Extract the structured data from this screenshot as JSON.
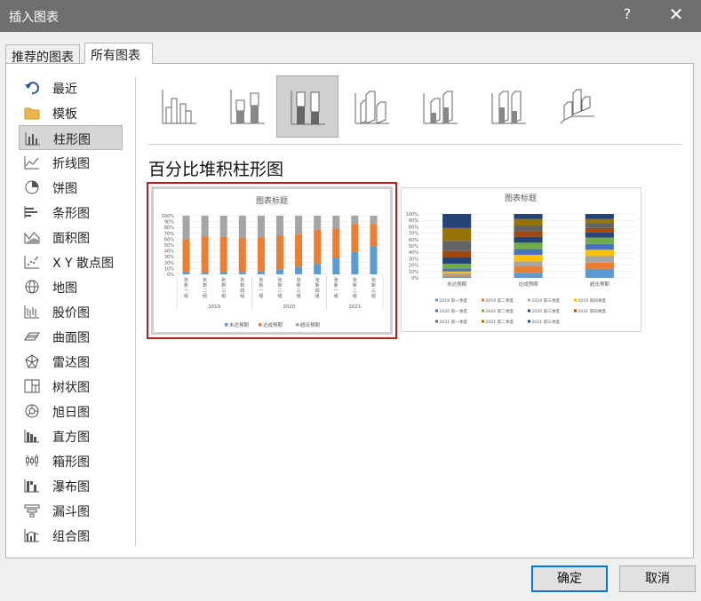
{
  "window": {
    "title": "插入图表",
    "help": "?",
    "close": "✕"
  },
  "tabs": [
    {
      "label": "推荐的图表",
      "active": false
    },
    {
      "label": "所有图表",
      "active": true
    }
  ],
  "sidebar": {
    "items": [
      {
        "label": "最近",
        "icon": "undo-arrow-icon"
      },
      {
        "label": "模板",
        "icon": "folder-icon"
      },
      {
        "label": "柱形图",
        "icon": "column-chart-icon",
        "selected": true
      },
      {
        "label": "折线图",
        "icon": "line-chart-icon"
      },
      {
        "label": "饼图",
        "icon": "pie-chart-icon"
      },
      {
        "label": "条形图",
        "icon": "bar-chart-icon"
      },
      {
        "label": "面积图",
        "icon": "area-chart-icon"
      },
      {
        "label": "X Y 散点图",
        "icon": "scatter-chart-icon"
      },
      {
        "label": "地图",
        "icon": "globe-icon"
      },
      {
        "label": "股价图",
        "icon": "stock-chart-icon"
      },
      {
        "label": "曲面图",
        "icon": "surface-chart-icon"
      },
      {
        "label": "雷达图",
        "icon": "radar-chart-icon"
      },
      {
        "label": "树状图",
        "icon": "treemap-chart-icon"
      },
      {
        "label": "旭日图",
        "icon": "sunburst-chart-icon"
      },
      {
        "label": "直方图",
        "icon": "histogram-chart-icon"
      },
      {
        "label": "箱形图",
        "icon": "box-whisker-chart-icon"
      },
      {
        "label": "瀑布图",
        "icon": "waterfall-chart-icon"
      },
      {
        "label": "漏斗图",
        "icon": "funnel-chart-icon"
      },
      {
        "label": "组合图",
        "icon": "combo-chart-icon"
      }
    ]
  },
  "subtypes": {
    "selected_index": 2,
    "count": 7
  },
  "chart_subtitle": "百分比堆积柱形图",
  "colors": {
    "blue": "#5b9bd5",
    "orange": "#ed7d31",
    "gray": "#a5a5a5",
    "yellow": "#ffc000",
    "darkblue": "#264478",
    "green": "#70ad47",
    "brown": "#9e480e",
    "olive": "#997300",
    "selection_border": "#c21b1b"
  },
  "chart_data": [
    {
      "type": "bar",
      "stacked": "percent",
      "title": "图表标题",
      "categories": [
        "张 新 一 组",
        "张 新 二 组",
        "张 新 三 组",
        "张 新 四 组",
        "张 新 一 组",
        "张 新 二 组",
        "张 新 三 组",
        "张 新 四 组",
        "张 新 一 组",
        "张 新 二 组",
        "张 新 三 组"
      ],
      "groups": [
        {
          "label": "2019",
          "count": 4
        },
        {
          "label": "2020",
          "count": 4
        },
        {
          "label": "2021",
          "count": 3
        }
      ],
      "yticks": [
        "100%",
        "90%",
        "80%",
        "70%",
        "60%",
        "50%",
        "40%",
        "30%",
        "20%",
        "10%",
        "0%"
      ],
      "series": [
        {
          "name": "未达预期",
          "values": [
            4,
            3,
            4,
            4,
            5,
            8,
            13,
            18,
            28,
            38,
            48
          ]
        },
        {
          "name": "达成预期",
          "values": [
            56,
            62,
            60,
            58,
            58,
            58,
            55,
            58,
            50,
            48,
            38
          ]
        },
        {
          "name": "超出预期",
          "values": [
            40,
            35,
            36,
            38,
            37,
            34,
            32,
            24,
            22,
            14,
            14
          ]
        }
      ],
      "ylim": [
        0,
        100
      ],
      "legend": "bottom"
    },
    {
      "type": "bar",
      "stacked": "percent",
      "title": "图表标题",
      "categories": [
        "未达预期",
        "达成预期",
        "超出预期"
      ],
      "yticks": [
        "100%",
        "90%",
        "80%",
        "70%",
        "60%",
        "50%",
        "40%",
        "30%",
        "20%",
        "10%",
        "0%"
      ],
      "series": [
        {
          "name": "2019 第一季度",
          "values": [
            2,
            8,
            14
          ]
        },
        {
          "name": "2019 第二季度",
          "values": [
            2,
            10,
            10
          ]
        },
        {
          "name": "2019 第三季度",
          "values": [
            3,
            8,
            10
          ]
        },
        {
          "name": "2019 第四季度",
          "values": [
            3,
            10,
            10
          ]
        },
        {
          "name": "2020 第一季度",
          "values": [
            5,
            9,
            9
          ]
        },
        {
          "name": "2020 第二季度",
          "values": [
            7,
            10,
            10
          ]
        },
        {
          "name": "2020 第三季度",
          "values": [
            10,
            9,
            8
          ]
        },
        {
          "name": "2020 第四季度",
          "values": [
            10,
            9,
            7
          ]
        },
        {
          "name": "2021 第一季度",
          "values": [
            16,
            9,
            8
          ]
        },
        {
          "name": "2021 第二季度",
          "values": [
            20,
            10,
            6
          ]
        },
        {
          "name": "2021 第三季度",
          "values": [
            22,
            8,
            8
          ]
        }
      ],
      "ylim": [
        0,
        100
      ],
      "legend": "bottom"
    }
  ],
  "buttons": {
    "ok": "确定",
    "cancel": "取消"
  }
}
